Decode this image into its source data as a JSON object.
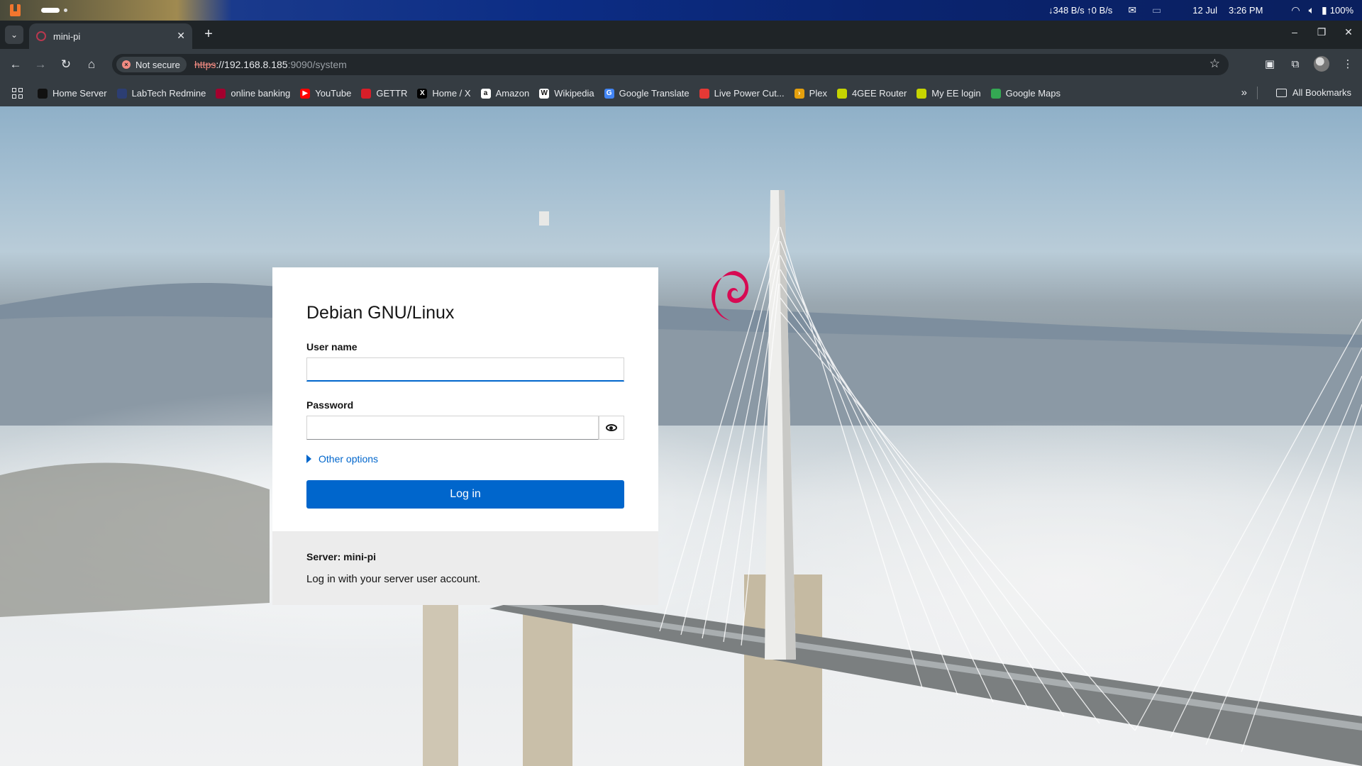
{
  "system_bar": {
    "net_speed": "↓348 B/s ↑0 B/s",
    "date": "12 Jul",
    "time": "3:26 PM",
    "battery": "100%",
    "icons": [
      "mail-icon",
      "clipboard-icon",
      "wifi-icon",
      "volume-icon",
      "battery-icon"
    ]
  },
  "browser": {
    "tab": {
      "title": "mini-pi"
    },
    "security_chip": "Not secure",
    "url": {
      "scheme": "https",
      "host": "://192.168.8.185",
      "rest": ":9090/system"
    },
    "bookmarks": [
      {
        "label": "Home Server",
        "color": "#111111",
        "glyph": ""
      },
      {
        "label": "LabTech Redmine",
        "color": "#2c3e73",
        "glyph": ""
      },
      {
        "label": "online banking",
        "color": "#a3002e",
        "glyph": ""
      },
      {
        "label": "YouTube",
        "color": "#ff0000",
        "glyph": "▶"
      },
      {
        "label": "GETTR",
        "color": "#d71e28",
        "glyph": ""
      },
      {
        "label": "Home / X",
        "color": "#000000",
        "glyph": "X"
      },
      {
        "label": "Amazon",
        "color": "#ffffff",
        "glyph": "a"
      },
      {
        "label": "Wikipedia",
        "color": "#ffffff",
        "glyph": "W"
      },
      {
        "label": "Google Translate",
        "color": "#4285f4",
        "glyph": "G"
      },
      {
        "label": "Live Power Cut...",
        "color": "#e53935",
        "glyph": ""
      },
      {
        "label": "Plex",
        "color": "#e5a00d",
        "glyph": "›"
      },
      {
        "label": "4GEE Router",
        "color": "#c6d400",
        "glyph": ""
      },
      {
        "label": "My EE login",
        "color": "#c6d400",
        "glyph": ""
      },
      {
        "label": "Google Maps",
        "color": "#34a853",
        "glyph": ""
      }
    ],
    "all_bookmarks": "All Bookmarks"
  },
  "login": {
    "brand": "Debian GNU/Linux",
    "username_label": "User name",
    "username_value": "",
    "password_label": "Password",
    "password_value": "",
    "other_options": "Other options",
    "login_button": "Log in",
    "server_label": "Server: mini-pi",
    "hint": "Log in with your server user account."
  },
  "colors": {
    "accent": "#0066cc",
    "debian_red": "#d70a53"
  }
}
